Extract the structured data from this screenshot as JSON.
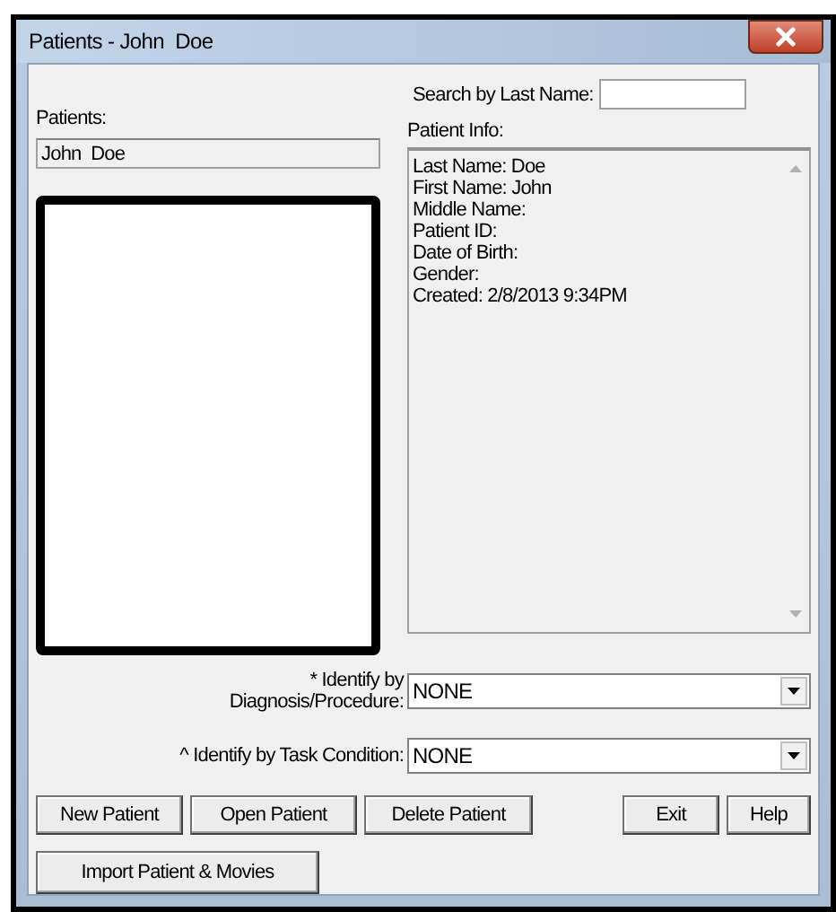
{
  "window": {
    "title": "Patients - John  Doe"
  },
  "patients": {
    "label": "Patients:",
    "items": [
      "John  Doe"
    ]
  },
  "search": {
    "label": "Search by Last Name:"
  },
  "patient_info": {
    "label": "Patient Info:",
    "lines": [
      "Last Name: Doe",
      "First Name: John",
      "Middle Name:",
      "Patient ID:",
      "Date of Birth:",
      "Gender:",
      "Created: 2/8/2013 9:34PM"
    ]
  },
  "filters": [
    {
      "label_lines": [
        "* Identify by",
        "Diagnosis/Procedure:"
      ],
      "value": "NONE"
    },
    {
      "label_lines": [
        "^ Identify by Task Condition:"
      ],
      "value": "NONE"
    }
  ],
  "buttons": [
    {
      "label": "New Patient",
      "kind": "left"
    },
    {
      "label": "Open Patient",
      "kind": "left"
    },
    {
      "label": "Delete Patient",
      "kind": "left"
    },
    {
      "label": "Exit",
      "kind": "right"
    },
    {
      "label": "Help",
      "kind": "right"
    }
  ],
  "import_button": "Import Patient & Movies"
}
